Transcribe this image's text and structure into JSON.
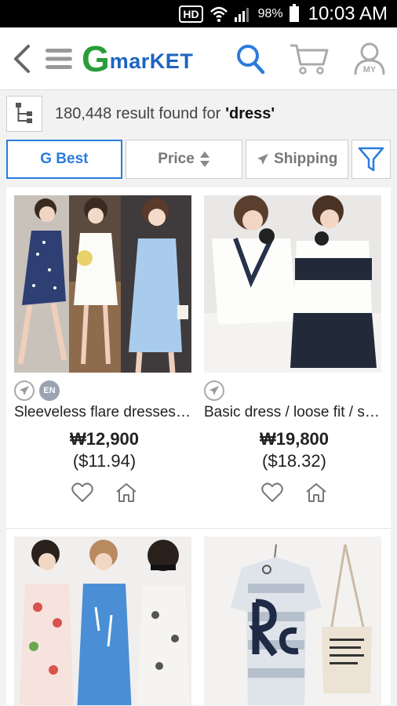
{
  "status": {
    "hd": "HD",
    "battery": "98%",
    "time": "10:03 AM"
  },
  "header": {
    "logo_g": "G",
    "logo_word": "marKET",
    "profile_label": "MY"
  },
  "results": {
    "count_text": "180,448 result found for",
    "query": "'dress'"
  },
  "filters": {
    "g_best": "G Best",
    "price": "Price",
    "shipping": "Shipping"
  },
  "products": [
    {
      "title": "Sleeveless flare dresses for women",
      "price": "₩12,900",
      "usd": "($11.94)",
      "has_en": true
    },
    {
      "title": "Basic dress / loose fit / stripe",
      "price": "₩19,800",
      "usd": "($18.32)",
      "has_en": false
    }
  ],
  "colors": {
    "accent": "#2a7bde",
    "brand_green": "#2a9d3a",
    "brand_blue": "#1e63c2"
  }
}
